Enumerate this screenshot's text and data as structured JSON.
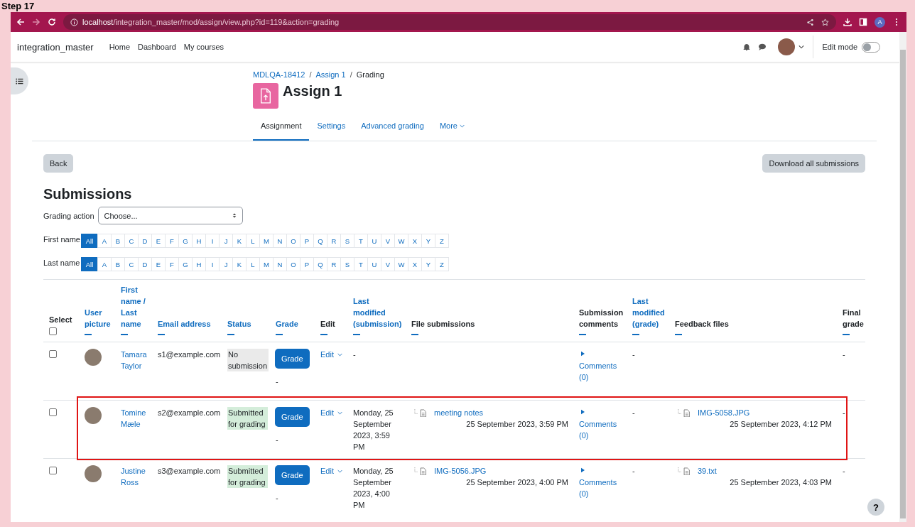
{
  "step_label": "Step 17",
  "browser": {
    "url_host": "localhost",
    "url_path": "/integration_master/mod/assign/view.php?id=119&action=grading",
    "profile_initial": "A"
  },
  "navbar": {
    "site_name": "integration_master",
    "links": [
      "Home",
      "Dashboard",
      "My courses"
    ],
    "edit_mode": {
      "label": "Edit mode",
      "on": false
    }
  },
  "breadcrumb": [
    {
      "label": "MDLQA-18412",
      "link": true,
      "separator": "/"
    },
    {
      "label": "Assign 1",
      "link": true,
      "separator": "/"
    },
    {
      "label": "Grading",
      "link": false
    }
  ],
  "title": "Assign 1",
  "tabs": [
    {
      "label": "Assignment",
      "selected": true,
      "dropdown": false
    },
    {
      "label": "Settings",
      "selected": false,
      "dropdown": false
    },
    {
      "label": "Advanced grading",
      "selected": false,
      "dropdown": false
    },
    {
      "label": "More",
      "selected": false,
      "dropdown": true
    }
  ],
  "back_button": "Back",
  "download_button": "Download all submissions",
  "heading": "Submissions",
  "grading_action": {
    "label": "Grading action",
    "value": "Choose..."
  },
  "initials_filters": [
    {
      "label": "First name",
      "letters": [
        {
          "label": "All",
          "selected": true
        },
        {
          "label": "A",
          "selected": false
        },
        {
          "label": "B",
          "selected": false
        },
        {
          "label": "C",
          "selected": false
        },
        {
          "label": "D",
          "selected": false
        },
        {
          "label": "E",
          "selected": false
        },
        {
          "label": "F",
          "selected": false
        },
        {
          "label": "G",
          "selected": false
        },
        {
          "label": "H",
          "selected": false
        },
        {
          "label": "I",
          "selected": false
        },
        {
          "label": "J",
          "selected": false
        },
        {
          "label": "K",
          "selected": false
        },
        {
          "label": "L",
          "selected": false
        },
        {
          "label": "M",
          "selected": false
        },
        {
          "label": "N",
          "selected": false
        },
        {
          "label": "O",
          "selected": false
        },
        {
          "label": "P",
          "selected": false
        },
        {
          "label": "Q",
          "selected": false
        },
        {
          "label": "R",
          "selected": false
        },
        {
          "label": "S",
          "selected": false
        },
        {
          "label": "T",
          "selected": false
        },
        {
          "label": "U",
          "selected": false
        },
        {
          "label": "V",
          "selected": false
        },
        {
          "label": "W",
          "selected": false
        },
        {
          "label": "X",
          "selected": false
        },
        {
          "label": "Y",
          "selected": false
        },
        {
          "label": "Z",
          "selected": false
        }
      ]
    },
    {
      "label": "Last name",
      "letters": [
        {
          "label": "All",
          "selected": true
        },
        {
          "label": "A",
          "selected": false
        },
        {
          "label": "B",
          "selected": false
        },
        {
          "label": "C",
          "selected": false
        },
        {
          "label": "D",
          "selected": false
        },
        {
          "label": "E",
          "selected": false
        },
        {
          "label": "F",
          "selected": false
        },
        {
          "label": "G",
          "selected": false
        },
        {
          "label": "H",
          "selected": false
        },
        {
          "label": "I",
          "selected": false
        },
        {
          "label": "J",
          "selected": false
        },
        {
          "label": "K",
          "selected": false
        },
        {
          "label": "L",
          "selected": false
        },
        {
          "label": "M",
          "selected": false
        },
        {
          "label": "N",
          "selected": false
        },
        {
          "label": "O",
          "selected": false
        },
        {
          "label": "P",
          "selected": false
        },
        {
          "label": "Q",
          "selected": false
        },
        {
          "label": "R",
          "selected": false
        },
        {
          "label": "S",
          "selected": false
        },
        {
          "label": "T",
          "selected": false
        },
        {
          "label": "U",
          "selected": false
        },
        {
          "label": "V",
          "selected": false
        },
        {
          "label": "W",
          "selected": false
        },
        {
          "label": "X",
          "selected": false
        },
        {
          "label": "Y",
          "selected": false
        },
        {
          "label": "Z",
          "selected": false
        }
      ]
    }
  ],
  "table": {
    "columns": [
      {
        "label": "Select",
        "kind": "select",
        "checked": false
      },
      {
        "label": "User picture",
        "kind": "sortable"
      },
      {
        "label": "First name / Last name",
        "kind": "sortable"
      },
      {
        "label": "Email address",
        "kind": "sortable"
      },
      {
        "label": "Status",
        "kind": "sortable"
      },
      {
        "label": "Grade",
        "kind": "sortable"
      },
      {
        "label": "Edit",
        "kind": "plain"
      },
      {
        "label": "Last modified (submission)",
        "kind": "sortable"
      },
      {
        "label": "File submissions",
        "kind": "plain"
      },
      {
        "label": "Submission comments",
        "kind": "plain"
      },
      {
        "label": "Last modified (grade)",
        "kind": "sortable"
      },
      {
        "label": "Feedback files",
        "kind": "plain"
      },
      {
        "label": "Final grade",
        "kind": "plain"
      }
    ],
    "rows": [
      {
        "checked": false,
        "highlighted": false,
        "name": "Tamara Taylor",
        "email": "s1@example.com",
        "status": {
          "label": "No submission",
          "kind": "none"
        },
        "grade_button": "Grade",
        "grade": "-",
        "edit": "Edit",
        "last_modified": "-",
        "comments": "Comments (0)",
        "last_modified_grade": "-",
        "final_grade": "-"
      },
      {
        "checked": false,
        "highlighted": true,
        "name": "Tomine Mæle",
        "email": "s2@example.com",
        "status": {
          "label": "Submitted for grading",
          "kind": "submitted"
        },
        "grade_button": "Grade",
        "grade": "-",
        "edit": "Edit",
        "last_modified": "Monday, 25 September 2023, 3:59 PM",
        "file": {
          "name": "meeting notes",
          "date": "25 September 2023, 3:59 PM"
        },
        "comments": "Comments (0)",
        "last_modified_grade": "-",
        "feedback_file": {
          "name": "IMG-5058.JPG",
          "date": "25 September 2023, 4:12 PM"
        },
        "final_grade": "-"
      },
      {
        "checked": false,
        "highlighted": false,
        "name": "Justine Ross",
        "email": "s3@example.com",
        "status": {
          "label": "Submitted for grading",
          "kind": "submitted"
        },
        "grade_button": "Grade",
        "grade": "-",
        "edit": "Edit",
        "last_modified": "Monday, 25 September 2023, 4:00 PM",
        "file": {
          "name": "IMG-5056.JPG",
          "date": "25 September 2023, 4:00 PM"
        },
        "comments": "Comments (0)",
        "last_modified_grade": "-",
        "feedback_file": {
          "name": "39.txt",
          "date": "25 September 2023, 4:03 PM"
        },
        "final_grade": "-"
      }
    ]
  },
  "help_button": "?"
}
